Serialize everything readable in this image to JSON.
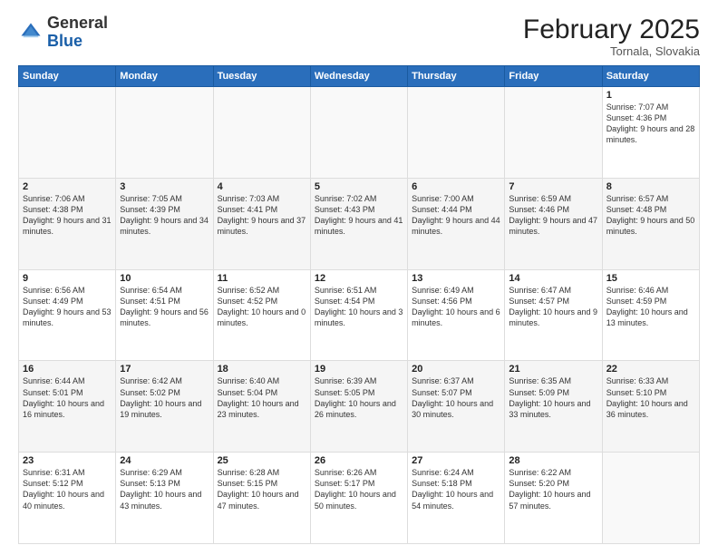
{
  "header": {
    "logo_line1": "General",
    "logo_line2": "Blue",
    "month": "February 2025",
    "location": "Tornala, Slovakia"
  },
  "days_of_week": [
    "Sunday",
    "Monday",
    "Tuesday",
    "Wednesday",
    "Thursday",
    "Friday",
    "Saturday"
  ],
  "weeks": [
    [
      {
        "day": "",
        "info": ""
      },
      {
        "day": "",
        "info": ""
      },
      {
        "day": "",
        "info": ""
      },
      {
        "day": "",
        "info": ""
      },
      {
        "day": "",
        "info": ""
      },
      {
        "day": "",
        "info": ""
      },
      {
        "day": "1",
        "info": "Sunrise: 7:07 AM\nSunset: 4:36 PM\nDaylight: 9 hours and 28 minutes."
      }
    ],
    [
      {
        "day": "2",
        "info": "Sunrise: 7:06 AM\nSunset: 4:38 PM\nDaylight: 9 hours and 31 minutes."
      },
      {
        "day": "3",
        "info": "Sunrise: 7:05 AM\nSunset: 4:39 PM\nDaylight: 9 hours and 34 minutes."
      },
      {
        "day": "4",
        "info": "Sunrise: 7:03 AM\nSunset: 4:41 PM\nDaylight: 9 hours and 37 minutes."
      },
      {
        "day": "5",
        "info": "Sunrise: 7:02 AM\nSunset: 4:43 PM\nDaylight: 9 hours and 41 minutes."
      },
      {
        "day": "6",
        "info": "Sunrise: 7:00 AM\nSunset: 4:44 PM\nDaylight: 9 hours and 44 minutes."
      },
      {
        "day": "7",
        "info": "Sunrise: 6:59 AM\nSunset: 4:46 PM\nDaylight: 9 hours and 47 minutes."
      },
      {
        "day": "8",
        "info": "Sunrise: 6:57 AM\nSunset: 4:48 PM\nDaylight: 9 hours and 50 minutes."
      }
    ],
    [
      {
        "day": "9",
        "info": "Sunrise: 6:56 AM\nSunset: 4:49 PM\nDaylight: 9 hours and 53 minutes."
      },
      {
        "day": "10",
        "info": "Sunrise: 6:54 AM\nSunset: 4:51 PM\nDaylight: 9 hours and 56 minutes."
      },
      {
        "day": "11",
        "info": "Sunrise: 6:52 AM\nSunset: 4:52 PM\nDaylight: 10 hours and 0 minutes."
      },
      {
        "day": "12",
        "info": "Sunrise: 6:51 AM\nSunset: 4:54 PM\nDaylight: 10 hours and 3 minutes."
      },
      {
        "day": "13",
        "info": "Sunrise: 6:49 AM\nSunset: 4:56 PM\nDaylight: 10 hours and 6 minutes."
      },
      {
        "day": "14",
        "info": "Sunrise: 6:47 AM\nSunset: 4:57 PM\nDaylight: 10 hours and 9 minutes."
      },
      {
        "day": "15",
        "info": "Sunrise: 6:46 AM\nSunset: 4:59 PM\nDaylight: 10 hours and 13 minutes."
      }
    ],
    [
      {
        "day": "16",
        "info": "Sunrise: 6:44 AM\nSunset: 5:01 PM\nDaylight: 10 hours and 16 minutes."
      },
      {
        "day": "17",
        "info": "Sunrise: 6:42 AM\nSunset: 5:02 PM\nDaylight: 10 hours and 19 minutes."
      },
      {
        "day": "18",
        "info": "Sunrise: 6:40 AM\nSunset: 5:04 PM\nDaylight: 10 hours and 23 minutes."
      },
      {
        "day": "19",
        "info": "Sunrise: 6:39 AM\nSunset: 5:05 PM\nDaylight: 10 hours and 26 minutes."
      },
      {
        "day": "20",
        "info": "Sunrise: 6:37 AM\nSunset: 5:07 PM\nDaylight: 10 hours and 30 minutes."
      },
      {
        "day": "21",
        "info": "Sunrise: 6:35 AM\nSunset: 5:09 PM\nDaylight: 10 hours and 33 minutes."
      },
      {
        "day": "22",
        "info": "Sunrise: 6:33 AM\nSunset: 5:10 PM\nDaylight: 10 hours and 36 minutes."
      }
    ],
    [
      {
        "day": "23",
        "info": "Sunrise: 6:31 AM\nSunset: 5:12 PM\nDaylight: 10 hours and 40 minutes."
      },
      {
        "day": "24",
        "info": "Sunrise: 6:29 AM\nSunset: 5:13 PM\nDaylight: 10 hours and 43 minutes."
      },
      {
        "day": "25",
        "info": "Sunrise: 6:28 AM\nSunset: 5:15 PM\nDaylight: 10 hours and 47 minutes."
      },
      {
        "day": "26",
        "info": "Sunrise: 6:26 AM\nSunset: 5:17 PM\nDaylight: 10 hours and 50 minutes."
      },
      {
        "day": "27",
        "info": "Sunrise: 6:24 AM\nSunset: 5:18 PM\nDaylight: 10 hours and 54 minutes."
      },
      {
        "day": "28",
        "info": "Sunrise: 6:22 AM\nSunset: 5:20 PM\nDaylight: 10 hours and 57 minutes."
      },
      {
        "day": "",
        "info": ""
      }
    ]
  ]
}
